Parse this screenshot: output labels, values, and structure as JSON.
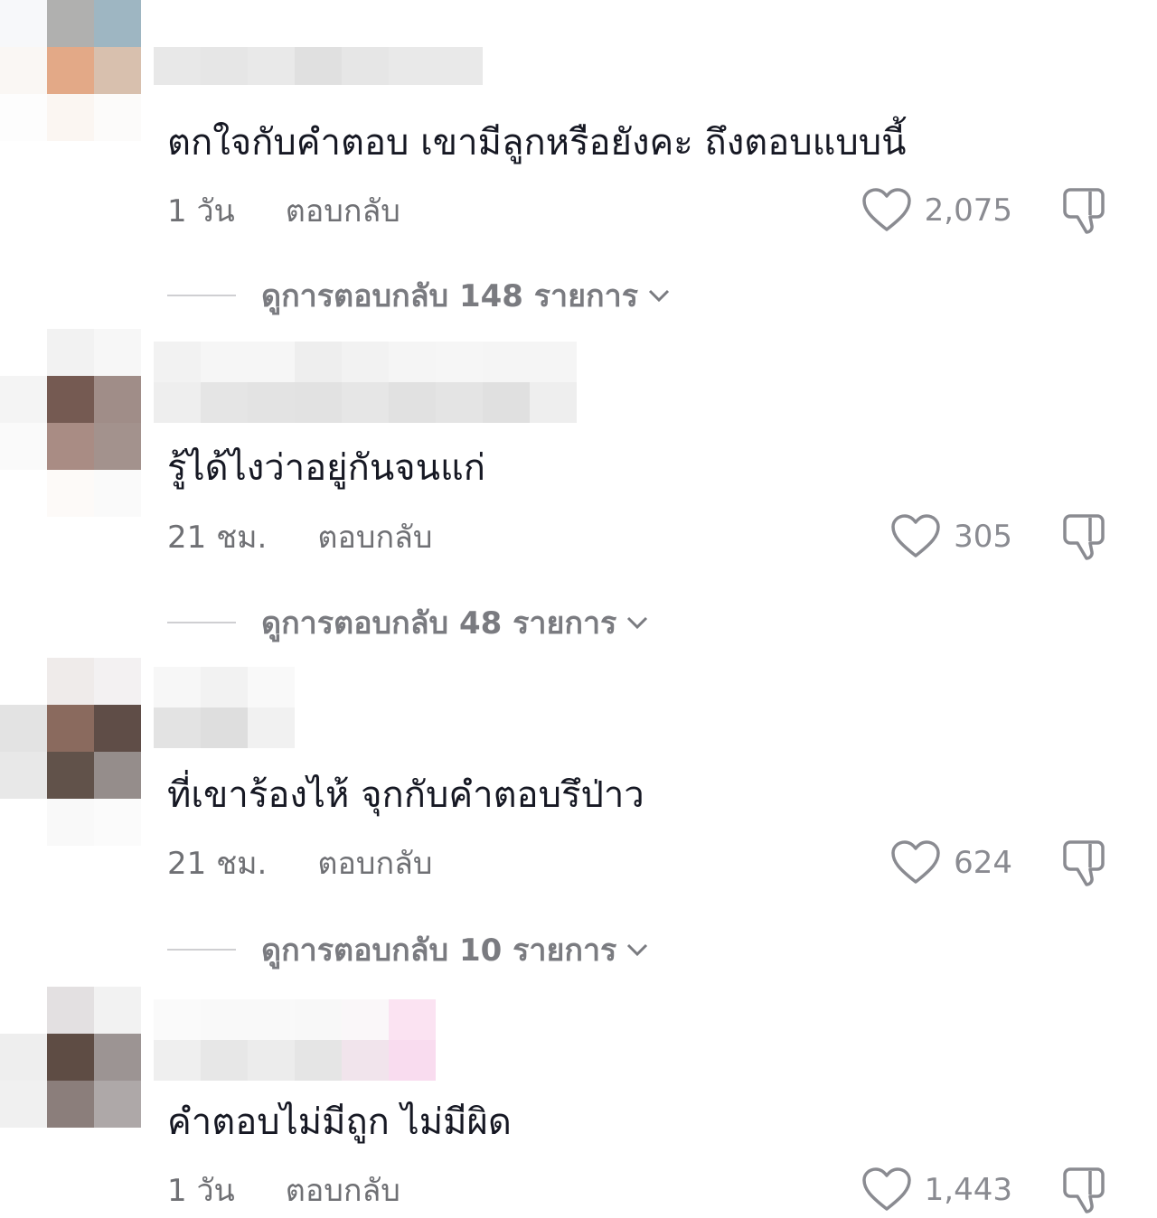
{
  "comments": [
    {
      "text": "ตกใจกับคำตอบ เขามีลูกหรือยังคะ ถึงตอบแบบนี้",
      "time": "1 วัน",
      "reply_label": "ตอบกลับ",
      "likes": "2,075",
      "view_replies": "ดูการตอบกลับ 148 รายการ",
      "avatar_colors": [
        "#f7f8fa",
        "#b0b0af",
        "#9eb6c2",
        "#faf7f4",
        "#e3a987",
        "#d8c0ae",
        "#fdfdfd",
        "#fbf6f2",
        "#fcfbfa",
        "#ffffff",
        "#ffffff",
        "#ffffff"
      ],
      "username_colors": [
        "#e8e8e8",
        "#e6e6e6",
        "#e9e9e9",
        "#e0e0e0",
        "#e6e6e6",
        "#e9e9e9",
        "#e9e9e9"
      ]
    },
    {
      "text": "รู้ได้ไงว่าอยู่กันจนแก่",
      "time": "21 ชม.",
      "reply_label": "ตอบกลับ",
      "likes": "305",
      "view_replies": "ดูการตอบกลับ 48 รายการ",
      "avatar_colors": [
        "#ffffff",
        "#f2f2f2",
        "#f7f7f7",
        "#f4f4f4",
        "#755a52",
        "#a08d88",
        "#fafafa",
        "#a98c84",
        "#a3928d",
        "#ffffff",
        "#fdfaf8",
        "#fafafa"
      ],
      "username_colors": [
        "#f2f2f2",
        "#f6f6f6",
        "#f6f6f6",
        "#eeeeee",
        "#f2f2f2",
        "#f5f5f5",
        "#f6f6f6",
        "#f5f5f5",
        "#f5f5f5",
        "#eeeeee",
        "#e5e5e5",
        "#e3e3e3",
        "#e2e2e2",
        "#e6e6e6",
        "#e1e1e1",
        "#e4e4e4",
        "#e0e0e0",
        "#eeeeee"
      ]
    },
    {
      "text": "ที่เขาร้องไห้ จุกกับคำตอบรึป่าว",
      "time": "21 ชม.",
      "reply_label": "ตอบกลับ",
      "likes": "624",
      "view_replies": "ดูการตอบกลับ 10 รายการ",
      "avatar_colors": [
        "#ffffff",
        "#efebea",
        "#f3f1f2",
        "#e3e3e3",
        "#8a6a5e",
        "#5f4d47",
        "#e8e8e8",
        "#61524a",
        "#958d8b",
        "#ffffff",
        "#f9f9f9",
        "#fbfbfb"
      ],
      "username_colors": [
        "#f7f7f7",
        "#f2f2f2",
        "#f9f9f9",
        "#e3e3e3",
        "#dedede",
        "#f1f1f1"
      ]
    },
    {
      "text": "คำตอบไม่มีถูก ไม่มีผิด",
      "time": "1 วัน",
      "reply_label": "ตอบกลับ",
      "likes": "1,443",
      "avatar_colors": [
        "#ffffff",
        "#e3e0e1",
        "#f2f2f2",
        "#eeeeee",
        "#5e4c44",
        "#9c9493",
        "#f0f0f0",
        "#8b7e7b",
        "#aea8a8",
        "#ffffff",
        "#ffffff",
        "#ffffff"
      ],
      "username_colors": [
        "#fafafa",
        "#f9f9f9",
        "#f9f9f9",
        "#f8f8f8",
        "#faf7f9",
        "#fbe3f2",
        "#efefef",
        "#e7e7e7",
        "#ececec",
        "#e5e5e5",
        "#f1e4ec",
        "#f9dcef"
      ]
    }
  ]
}
